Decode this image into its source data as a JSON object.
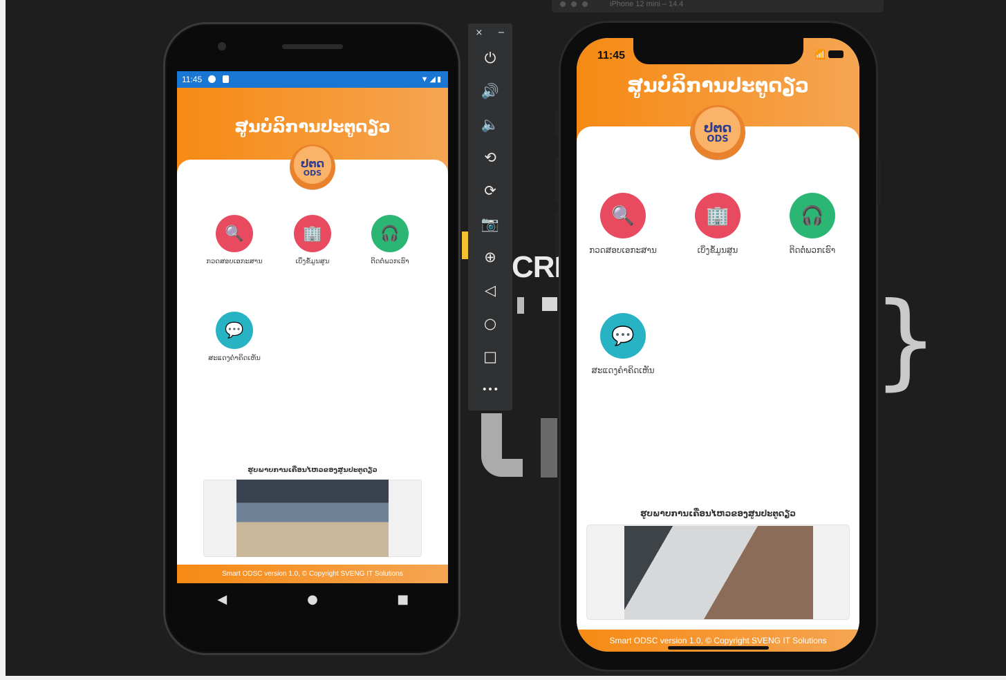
{
  "colors": {
    "brand_orange": "#f68a14",
    "android_status_blue": "#1976d2",
    "tile_colors": [
      "#e84a5f",
      "#e84a5f",
      "#2bb673",
      "#27b3c4"
    ]
  },
  "android": {
    "status": {
      "time": "11:45",
      "right_icons": "wifi-icon signal-icon battery-icon"
    },
    "app": {
      "title": "ສູນບໍລິການປະຕູດຽວ",
      "logo": {
        "line1": "ປຕດ",
        "line2": "ODS"
      },
      "tiles": [
        {
          "label": "ກວດສອບເອກະສານ",
          "icon": "document-search-icon"
        },
        {
          "label": "ເບິ່ງຂໍ້ມູນສູນ",
          "icon": "building-icon"
        },
        {
          "label": "ຕິດຕໍ່ພວກເຮົາ",
          "icon": "support-agent-icon"
        },
        {
          "label": "ສະແດງຄຳຄິດເຫັນ",
          "icon": "feedback-icon"
        }
      ],
      "photo_caption": "ຮູບພາບການເຄື່ອນໄຫວຂອງສູນປະຕູດຽວ",
      "footer": "Smart ODSC version 1.0, © Copyright SVENG IT Solutions"
    },
    "nav": {
      "back": "◀",
      "home": "●",
      "recent": "■"
    }
  },
  "emulator_toolbar": {
    "close": "×",
    "minimize": "−",
    "buttons": [
      {
        "name": "power-icon",
        "glyph": "⏻"
      },
      {
        "name": "volume-up-icon",
        "glyph": "🔊"
      },
      {
        "name": "volume-down-icon",
        "glyph": "🔈"
      },
      {
        "name": "rotate-left-icon",
        "glyph": "⟲"
      },
      {
        "name": "rotate-right-icon",
        "glyph": "⟳"
      },
      {
        "name": "camera-icon",
        "glyph": "📷"
      },
      {
        "name": "zoom-icon",
        "glyph": "⊕"
      },
      {
        "name": "back-icon",
        "glyph": "◁"
      },
      {
        "name": "home-icon",
        "glyph": "○"
      },
      {
        "name": "overview-icon",
        "glyph": "□"
      },
      {
        "name": "more-icon",
        "glyph": "•••"
      }
    ]
  },
  "iphone": {
    "status": {
      "time": "11:45"
    },
    "app": {
      "title": "ສູນບໍລິການປະຕູດຽວ",
      "logo": {
        "line1": "ປຕດ",
        "line2": "ODS"
      },
      "tiles": [
        {
          "label": "ກວດສອບເອກະສານ",
          "icon": "document-search-icon"
        },
        {
          "label": "ເບິ່ງຂໍ້ມູນສູນ",
          "icon": "building-icon"
        },
        {
          "label": "ຕິດຕໍ່ພວກເຮົາ",
          "icon": "support-agent-icon"
        },
        {
          "label": "ສະແດງຄຳຄິດເຫັນ",
          "icon": "feedback-icon"
        }
      ],
      "photo_caption": "ຮູບພາບການເຄື່ອນໄຫວຂອງສູນປະຕູດຽວ",
      "footer": "Smart ODSC version 1.0, © Copyright SVENG IT Solutions"
    }
  },
  "background": {
    "partial_text": "CREA",
    "simulator_title": "iPhone 12 mini – 14.4"
  }
}
